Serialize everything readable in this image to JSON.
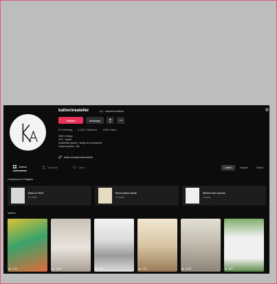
{
  "profile": {
    "username": "katherineatelier",
    "display_name": "Ky · katherineatelier",
    "follow_label": "Follow",
    "message_label": "Message",
    "following": "5 Following",
    "followers": "4,421 Followers",
    "likes": "109K Likes",
    "bio_lines": [
      "Interior Design",
      "CEO · Kiyoko",
      "Sustainable spaces · design for everyday life",
      "Project inquiries · DM"
    ],
    "link": "linktr.ee/katherineatelier"
  },
  "tabs": [
    {
      "label": "Videos",
      "icon": "grid-icon"
    },
    {
      "label": "Reposts",
      "icon": "repost-icon"
    },
    {
      "label": "Liked",
      "icon": "heart-icon"
    }
  ],
  "sort_options": [
    "Latest",
    "Popular",
    "Oldest"
  ],
  "sections": {
    "playlists": "Collections & Playlists",
    "videos": "Videos"
  },
  "playlists": [
    {
      "title": "Best of 2023",
      "count": "24 posts",
      "thumb_color": "#d8d8d8"
    },
    {
      "title": "Renovation ideas",
      "count": "14 posts",
      "thumb_color": "#e8dcc0"
    },
    {
      "title": "Behind the scenes",
      "count": "9 posts",
      "thumb_color": "#f0f0f0"
    }
  ],
  "videos": [
    {
      "views": "1.2K",
      "colors": [
        "#d9c235",
        "#3aa36b",
        "#e26a3a"
      ]
    },
    {
      "views": "3,456",
      "colors": [
        "#c9c2b8",
        "#a99f94",
        "#e8e3dc"
      ]
    },
    {
      "views": "890",
      "colors": [
        "#f2f2f2",
        "#9b9b9b",
        "#dcdcdc"
      ]
    },
    {
      "views": "2.1K",
      "colors": [
        "#d8c6a4",
        "#9a7a58",
        "#f1e7d4"
      ]
    },
    {
      "views": "5,012",
      "colors": [
        "#bfb8aa",
        "#8c8578",
        "#e4e0d6"
      ]
    },
    {
      "views": "640",
      "colors": [
        "#7fae6a",
        "#f0f0f0",
        "#5d8b4a"
      ]
    }
  ],
  "colors": {
    "accent": "#e8325a",
    "background": "#0c0c0c",
    "frame": "#bdbdbd"
  }
}
